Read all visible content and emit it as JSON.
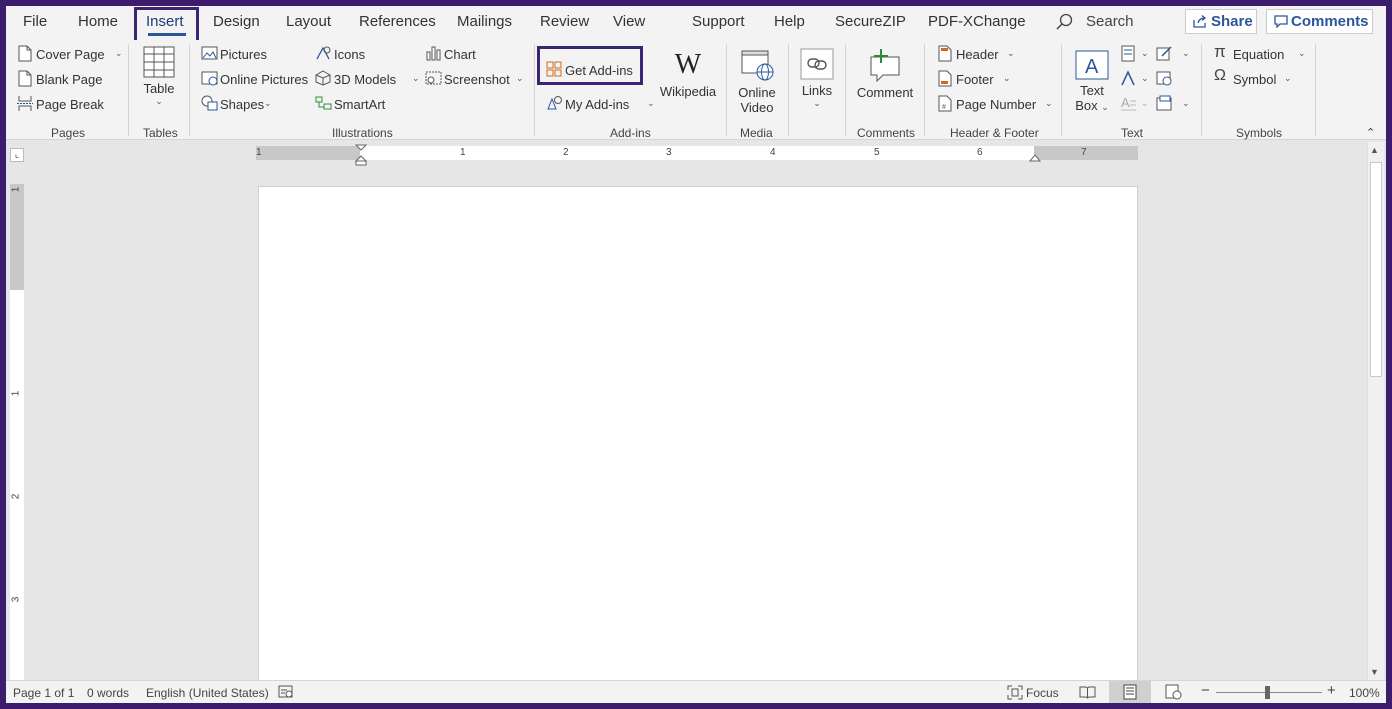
{
  "tabs": [
    "File",
    "Home",
    "Insert",
    "Design",
    "Layout",
    "References",
    "Mailings",
    "Review",
    "View",
    "Support",
    "Help",
    "SecureZIP",
    "PDF-XChange"
  ],
  "active_tab": "Insert",
  "search": {
    "label": "Search"
  },
  "share": {
    "label": "Share"
  },
  "comments_btn": {
    "label": "Comments"
  },
  "ribbon": {
    "pages": {
      "cover_page": "Cover Page",
      "blank_page": "Blank Page",
      "page_break": "Page Break",
      "label": "Pages"
    },
    "tables": {
      "table": "Table",
      "label": "Tables"
    },
    "illustrations": {
      "pictures": "Pictures",
      "online_pictures": "Online Pictures",
      "shapes": "Shapes",
      "icons": "Icons",
      "models_3d": "3D Models",
      "smartart": "SmartArt",
      "chart": "Chart",
      "screenshot": "Screenshot",
      "label": "Illustrations"
    },
    "addins": {
      "get_addins": "Get Add-ins",
      "my_addins": "My Add-ins",
      "wikipedia": "Wikipedia",
      "label": "Add-ins"
    },
    "media": {
      "online_video_1": "Online",
      "online_video_2": "Video",
      "label": "Media"
    },
    "links": {
      "links": "Links"
    },
    "comments": {
      "comment": "Comment",
      "label": "Comments"
    },
    "header_footer": {
      "header": "Header",
      "footer": "Footer",
      "page_number": "Page Number",
      "label": "Header & Footer"
    },
    "text": {
      "text_box_1": "Text",
      "text_box_2": "Box",
      "label": "Text"
    },
    "symbols": {
      "equation": "Equation",
      "symbol": "Symbol",
      "label": "Symbols"
    }
  },
  "ruler_h_numbers": [
    "1",
    "1",
    "2",
    "3",
    "4",
    "5",
    "6",
    "7"
  ],
  "ruler_v_numbers": [
    "1",
    "1",
    "2",
    "3"
  ],
  "status": {
    "page": "Page 1 of 1",
    "words": "0 words",
    "language": "English (United States)",
    "focus": "Focus",
    "zoom": "100%"
  },
  "colors": {
    "accent": "#2b579a",
    "highlight_border": "#3b2472"
  }
}
